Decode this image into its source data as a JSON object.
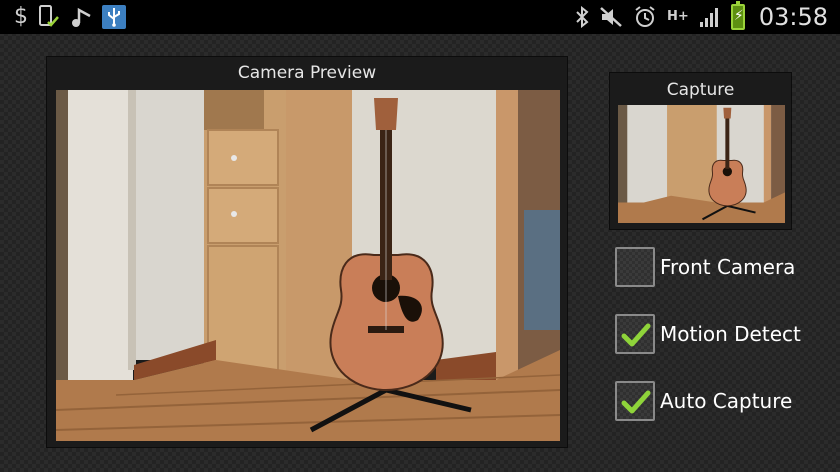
{
  "status_bar": {
    "time": "03:58",
    "network_type": "H+",
    "left_icons": [
      "dollar-icon",
      "phone-check-icon",
      "music-note-icon",
      "usb-icon"
    ],
    "right_icons": [
      "bluetooth-icon",
      "mute-icon",
      "alarm-icon",
      "data-hplus-icon",
      "signal-icon",
      "battery-charging-icon"
    ]
  },
  "preview": {
    "title": "Camera Preview",
    "image_subject": "acoustic guitar on a stand in a room corner"
  },
  "capture": {
    "title": "Capture"
  },
  "options": [
    {
      "label": "Front Camera",
      "checked": false
    },
    {
      "label": "Motion Detect",
      "checked": true
    },
    {
      "label": "Auto Capture",
      "checked": true
    }
  ],
  "colors": {
    "checkmark": "#8fd43a",
    "status_bar": "#000000",
    "usb_badge": "#3c7fc0",
    "battery": "#9bd33a"
  }
}
